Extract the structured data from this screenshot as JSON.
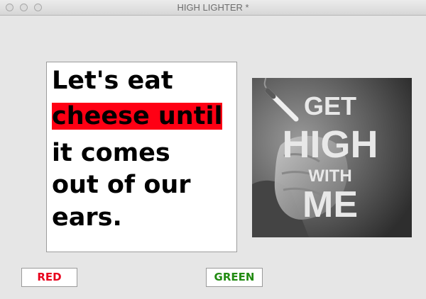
{
  "window": {
    "title": "HIGH LIGHTER *"
  },
  "text_panel": {
    "lines": [
      {
        "text": "Let's eat",
        "highlighted": false
      },
      {
        "text": "cheese until",
        "highlighted": true
      },
      {
        "text": "it comes",
        "highlighted": false
      },
      {
        "text": "out of our",
        "highlighted": false
      },
      {
        "text": "ears.",
        "highlighted": false
      }
    ],
    "highlight_color": "#ff0014"
  },
  "photo": {
    "caption_lines": [
      "GET",
      "HIGH",
      "WITH",
      "ME"
    ]
  },
  "buttons": {
    "red_label": "RED",
    "green_label": "GREEN",
    "red_color": "#e8001c",
    "green_color": "#228b12"
  }
}
